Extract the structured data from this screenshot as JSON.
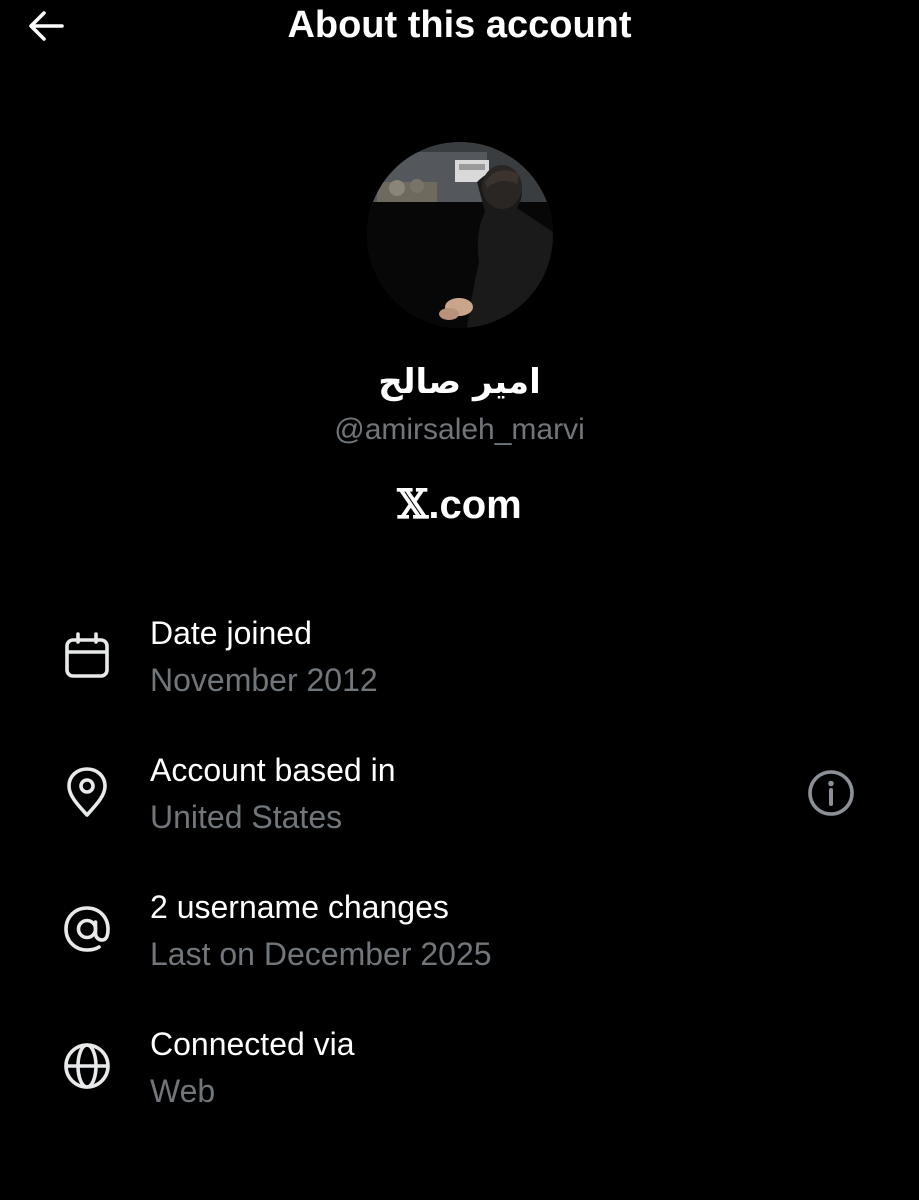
{
  "header": {
    "title": "About this account",
    "back_icon": "arrow-left-icon"
  },
  "profile": {
    "display_name": "امیر صالح",
    "handle": "@amirsaleh_marvi",
    "platform_glyph": "𝕏",
    "platform_suffix": ".com"
  },
  "details": [
    {
      "icon": "calendar-icon",
      "title": "Date joined",
      "value": "November 2012"
    },
    {
      "icon": "location-pin-icon",
      "title": "Account based in",
      "value": "United States",
      "action_icon": "info-icon"
    },
    {
      "icon": "at-sign-icon",
      "title": "2 username changes",
      "value": "Last on December 2025"
    },
    {
      "icon": "globe-icon",
      "title": "Connected via",
      "value": "Web"
    }
  ],
  "colors": {
    "background": "#000000",
    "primary_text": "#ffffff",
    "secondary_text": "#71767b"
  }
}
